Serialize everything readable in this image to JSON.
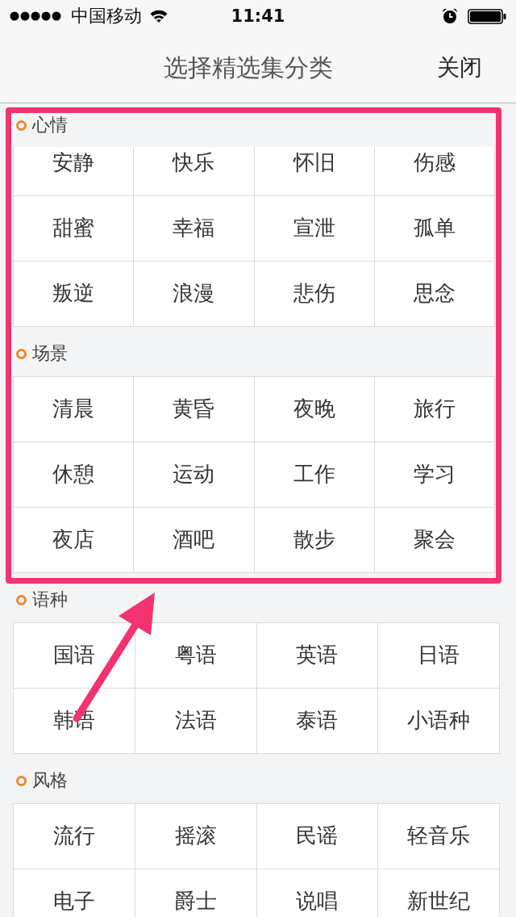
{
  "status_bar": {
    "carrier": "中国移动",
    "time": "11:41"
  },
  "header": {
    "title": "选择精选集分类",
    "close_button": "关闭"
  },
  "sections": [
    {
      "title": "心情",
      "highlighted": true,
      "items": [
        "安静",
        "快乐",
        "怀旧",
        "伤感",
        "甜蜜",
        "幸福",
        "宣泄",
        "孤单",
        "叛逆",
        "浪漫",
        "悲伤",
        "思念"
      ]
    },
    {
      "title": "场景",
      "highlighted": true,
      "items": [
        "清晨",
        "黄昏",
        "夜晚",
        "旅行",
        "休憩",
        "运动",
        "工作",
        "学习",
        "夜店",
        "酒吧",
        "散步",
        "聚会"
      ]
    },
    {
      "title": "语种",
      "highlighted": false,
      "items": [
        "国语",
        "粤语",
        "英语",
        "日语",
        "韩语",
        "法语",
        "泰语",
        "小语种"
      ]
    },
    {
      "title": "风格",
      "highlighted": false,
      "items": [
        "流行",
        "摇滚",
        "民谣",
        "轻音乐",
        "电子",
        "爵士",
        "说唱",
        "新世纪"
      ]
    }
  ],
  "annotation_arrow": true
}
